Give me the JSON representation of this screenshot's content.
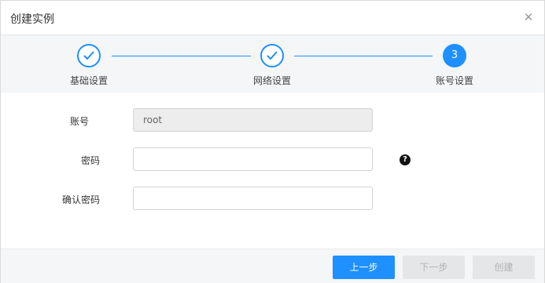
{
  "dialog": {
    "title": "创建实例",
    "close_icon": "close-icon"
  },
  "steps": [
    {
      "label": "基础设置",
      "state": "done",
      "icon": "check-icon"
    },
    {
      "label": "网络设置",
      "state": "done",
      "icon": "check-icon"
    },
    {
      "label": "账号设置",
      "state": "active",
      "number": "3"
    }
  ],
  "form": {
    "account": {
      "label": "账号",
      "value": "root"
    },
    "password": {
      "label": "密码",
      "value": "",
      "help_icon": "question-circle-icon"
    },
    "confirm_password": {
      "label": "确认密码",
      "value": ""
    }
  },
  "footer": {
    "prev_label": "上一步",
    "next_label": "下一步",
    "create_label": "创建"
  },
  "colors": {
    "accent": "#1e90ff",
    "disabled_bg": "#e4e6e8",
    "disabled_text": "#b3b3b3"
  }
}
